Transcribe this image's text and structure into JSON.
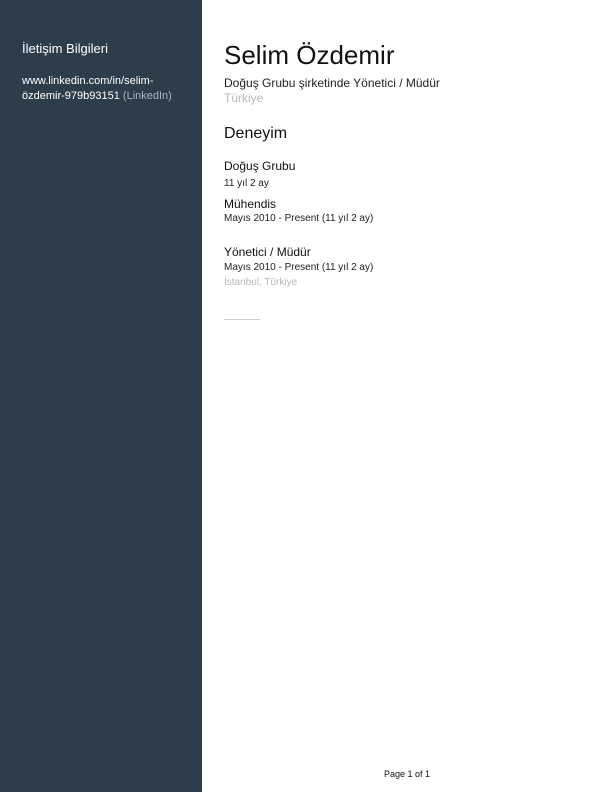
{
  "sidebar": {
    "heading": "İletişim Bilgileri",
    "contact": {
      "link_line1": "www.linkedin.com/in/selim-",
      "link_line2": "özdemir-979b93151",
      "link_type": "(LinkedIn)"
    }
  },
  "profile": {
    "name": "Selim Özdemir",
    "headline": "Doğuş Grubu şirketinde Yönetici / Müdür",
    "location": "Türkiye"
  },
  "experience": {
    "section_title": "Deneyim",
    "company": "Doğuş Grubu",
    "total_tenure": "11 yıl 2 ay",
    "roles": [
      {
        "title": "Mühendis",
        "dates": "Mayıs 2010 - Present (11 yıl 2 ay)"
      },
      {
        "title": "Yönetici / Müdür",
        "dates": "Mayıs 2010 - Present (11 yıl 2 ay)",
        "location": "İstanbul, Türkiye"
      }
    ]
  },
  "footer": {
    "page_number": "Page 1 of 1"
  },
  "colors": {
    "sidebar_bg": "#2d3e4a",
    "muted_text": "#b8b8b8"
  }
}
